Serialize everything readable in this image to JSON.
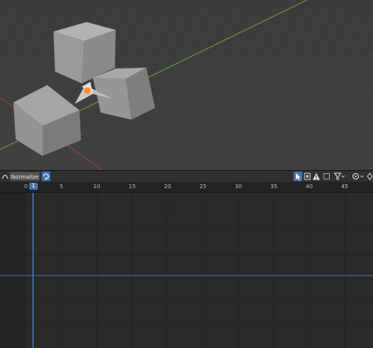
{
  "toolbar": {
    "normalize_label": "Normalize"
  },
  "timeline": {
    "ticks": [
      "0",
      "5",
      "10",
      "15",
      "20",
      "25",
      "30",
      "35",
      "40",
      "45"
    ],
    "current_frame": "1"
  },
  "colors": {
    "accent": "#4772b3",
    "grid_line_x_axis": "#a33b3b",
    "grid_line_y_axis": "#6f9a3a",
    "object_gray": "#8c8c8c"
  },
  "icons": {
    "editor_type": "graph-editor-icon",
    "normalize_toggle": "refresh-icon",
    "filters": [
      "cursor-select-icon",
      "keyframe-select-icon",
      "warning-icon",
      "box-icon",
      "filter-funnel-icon",
      "pivot-icon"
    ]
  }
}
